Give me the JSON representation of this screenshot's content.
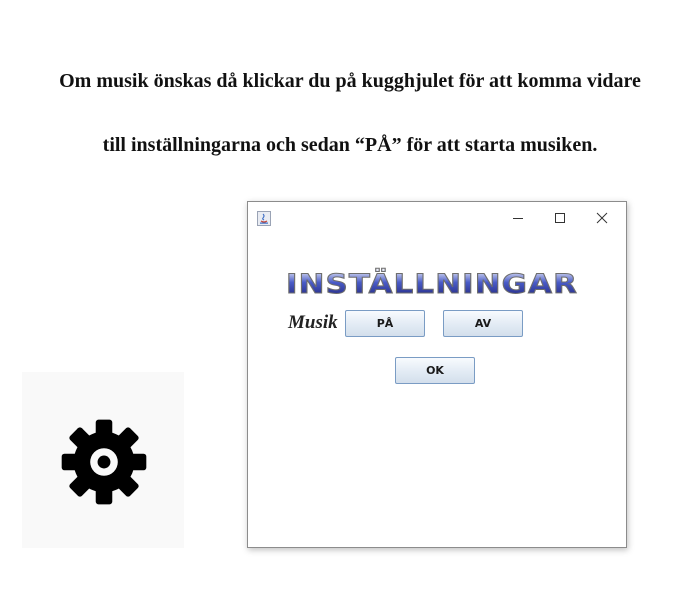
{
  "instructions": {
    "line1": "Om musik önskas då klickar du på kugghjulet för att komma vidare",
    "line2": "till inställningarna och sedan “PÅ” för att starta musiken."
  },
  "gear": {
    "icon": "gear-icon",
    "color": "#000000"
  },
  "window": {
    "app_icon": "java-app-icon",
    "controls": {
      "minimize_icon": "minimize-icon",
      "maximize_icon": "maximize-icon",
      "close_icon": "close-icon"
    },
    "heading": "INSTÄLLNINGAR",
    "heading_colors": {
      "top": "#ffffff",
      "mid": "#4a5cc8",
      "bottom": "#1c1f73",
      "outline": "#6e6e6e"
    },
    "music_label": "Musik",
    "buttons": {
      "on": "PÅ",
      "off": "AV",
      "ok": "OK"
    }
  }
}
